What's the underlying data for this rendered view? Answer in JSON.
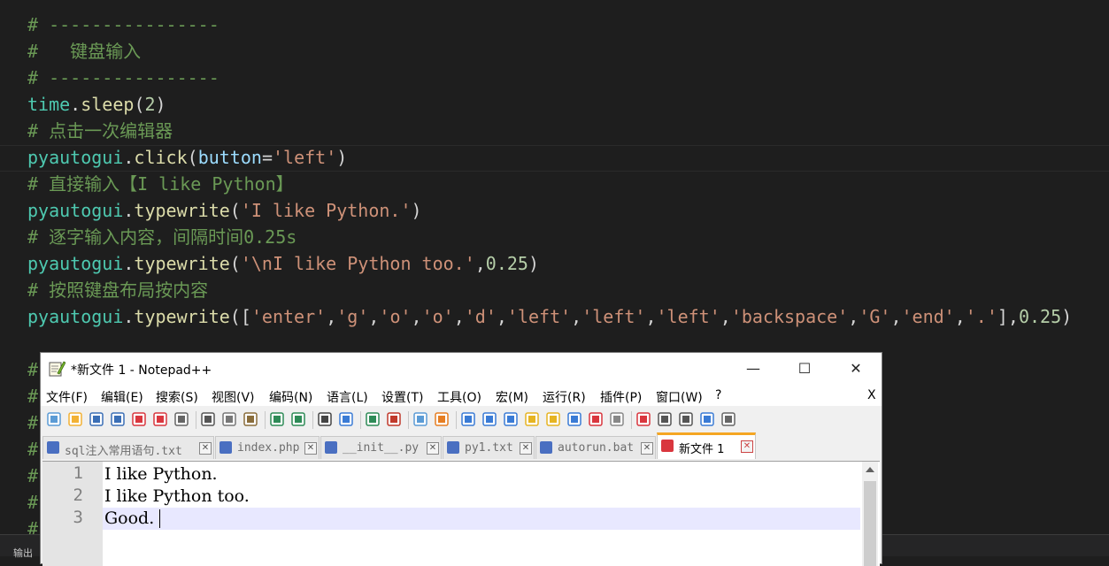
{
  "editor": {
    "colors": {
      "background": "#1e1e1e",
      "comment": "#6a9955",
      "variable": "#4ec9b0",
      "function": "#dcdcaa",
      "string": "#ce9178",
      "number": "#b5cea8",
      "param": "#9cdcfe"
    },
    "lines": [
      {
        "tokens": [
          {
            "t": "# ----------------",
            "c": "comment"
          }
        ]
      },
      {
        "tokens": [
          {
            "t": "#   键盘输入",
            "c": "comment"
          }
        ]
      },
      {
        "tokens": [
          {
            "t": "# ----------------",
            "c": "comment"
          }
        ]
      },
      {
        "tokens": [
          {
            "t": "time",
            "c": "var"
          },
          {
            "t": ".",
            "c": "punc"
          },
          {
            "t": "sleep",
            "c": "func"
          },
          {
            "t": "(",
            "c": "punc"
          },
          {
            "t": "2",
            "c": "num"
          },
          {
            "t": ")",
            "c": "punc"
          }
        ]
      },
      {
        "tokens": [
          {
            "t": "# 点击一次编辑器",
            "c": "comment"
          }
        ]
      },
      {
        "tokens": [
          {
            "t": "pyautogui",
            "c": "var"
          },
          {
            "t": ".",
            "c": "punc"
          },
          {
            "t": "click",
            "c": "func"
          },
          {
            "t": "(",
            "c": "punc"
          },
          {
            "t": "button",
            "c": "param"
          },
          {
            "t": "=",
            "c": "op"
          },
          {
            "t": "'left'",
            "c": "str"
          },
          {
            "t": ")",
            "c": "punc"
          }
        ]
      },
      {
        "tokens": [
          {
            "t": "# 直接输入【I like Python】",
            "c": "comment"
          }
        ]
      },
      {
        "tokens": [
          {
            "t": "pyautogui",
            "c": "var"
          },
          {
            "t": ".",
            "c": "punc"
          },
          {
            "t": "typewrite",
            "c": "func"
          },
          {
            "t": "(",
            "c": "punc"
          },
          {
            "t": "'I like Python.'",
            "c": "str"
          },
          {
            "t": ")",
            "c": "punc"
          }
        ]
      },
      {
        "tokens": [
          {
            "t": "# 逐字输入内容，间隔时间0.25s",
            "c": "comment"
          }
        ]
      },
      {
        "tokens": [
          {
            "t": "pyautogui",
            "c": "var"
          },
          {
            "t": ".",
            "c": "punc"
          },
          {
            "t": "typewrite",
            "c": "func"
          },
          {
            "t": "(",
            "c": "punc"
          },
          {
            "t": "'\\nI like Python too.'",
            "c": "str"
          },
          {
            "t": ",",
            "c": "punc"
          },
          {
            "t": "0.25",
            "c": "num"
          },
          {
            "t": ")",
            "c": "punc"
          }
        ]
      },
      {
        "tokens": [
          {
            "t": "# 按照键盘布局按内容",
            "c": "comment"
          }
        ]
      },
      {
        "tokens": [
          {
            "t": "pyautogui",
            "c": "var"
          },
          {
            "t": ".",
            "c": "punc"
          },
          {
            "t": "typewrite",
            "c": "func"
          },
          {
            "t": "([",
            "c": "punc"
          },
          {
            "t": "'enter'",
            "c": "str"
          },
          {
            "t": ",",
            "c": "punc"
          },
          {
            "t": "'g'",
            "c": "str"
          },
          {
            "t": ",",
            "c": "punc"
          },
          {
            "t": "'o'",
            "c": "str"
          },
          {
            "t": ",",
            "c": "punc"
          },
          {
            "t": "'o'",
            "c": "str"
          },
          {
            "t": ",",
            "c": "punc"
          },
          {
            "t": "'d'",
            "c": "str"
          },
          {
            "t": ",",
            "c": "punc"
          },
          {
            "t": "'left'",
            "c": "str"
          },
          {
            "t": ",",
            "c": "punc"
          },
          {
            "t": "'left'",
            "c": "str"
          },
          {
            "t": ",",
            "c": "punc"
          },
          {
            "t": "'left'",
            "c": "str"
          },
          {
            "t": ",",
            "c": "punc"
          },
          {
            "t": "'backspace'",
            "c": "str"
          },
          {
            "t": ",",
            "c": "punc"
          },
          {
            "t": "'G'",
            "c": "str"
          },
          {
            "t": ",",
            "c": "punc"
          },
          {
            "t": "'end'",
            "c": "str"
          },
          {
            "t": ",",
            "c": "punc"
          },
          {
            "t": "'.'",
            "c": "str"
          },
          {
            "t": "],",
            "c": "punc"
          },
          {
            "t": "0.25",
            "c": "num"
          },
          {
            "t": ")",
            "c": "punc"
          }
        ]
      }
    ],
    "partial_hash_lines": [
      "#",
      "#",
      "#",
      "#",
      "#",
      "#",
      "#"
    ],
    "output_panel_label": "输出"
  },
  "npp": {
    "title": "*新文件 1 - Notepad++",
    "window_buttons": {
      "minimize": "—",
      "maximize": "☐",
      "close": "✕"
    },
    "menu": [
      "文件(F)",
      "编辑(E)",
      "搜索(S)",
      "视图(V)",
      "编码(N)",
      "语言(L)",
      "设置(T)",
      "工具(O)",
      "宏(M)",
      "运行(R)",
      "插件(P)",
      "窗口(W)",
      "?"
    ],
    "menu_close": "X",
    "toolbar_icons": [
      "new-file-icon",
      "open-file-icon",
      "save-icon",
      "save-all-icon",
      "close-icon",
      "close-all-icon",
      "print-icon",
      "cut-icon",
      "copy-icon",
      "paste-icon",
      "undo-icon",
      "redo-icon",
      "find-icon",
      "replace-icon",
      "zoom-in-icon",
      "zoom-out-icon",
      "sync-vertical-icon",
      "sync-horizontal-icon",
      "word-wrap-icon",
      "show-all-chars-icon",
      "indent-guide-icon",
      "user-language-icon",
      "doc-map-icon",
      "function-list-icon",
      "folder-as-workspace-icon",
      "monitoring-icon",
      "record-macro-icon",
      "stop-macro-icon",
      "play-macro-icon",
      "run-macro-multiple-icon",
      "save-macro-icon"
    ],
    "tabs": [
      {
        "label": "sql注入常用语句.txt",
        "active": false
      },
      {
        "label": "index.php",
        "active": false
      },
      {
        "label": "__init__.py",
        "active": false
      },
      {
        "label": "py1.txt",
        "active": false
      },
      {
        "label": "autorun.bat",
        "active": false
      },
      {
        "label": "新文件 1",
        "active": true
      }
    ],
    "tab_close_glyph": "✕",
    "line_numbers": [
      "1",
      "2",
      "3"
    ],
    "lines": [
      "I like Python.",
      "I like Python too.",
      "Good."
    ],
    "colors": {
      "active_tab_accent": "#f5a623",
      "current_line": "#e8e8ff",
      "gutter": "#e4e4e4"
    }
  }
}
